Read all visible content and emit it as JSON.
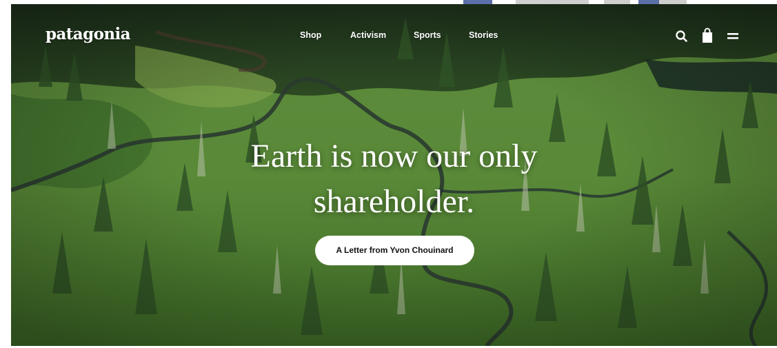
{
  "brand": {
    "logo_text": "patagonia"
  },
  "nav": {
    "items": [
      {
        "label": "Shop"
      },
      {
        "label": "Activism"
      },
      {
        "label": "Sports"
      },
      {
        "label": "Stories"
      }
    ]
  },
  "header_icons": [
    {
      "name": "search-icon"
    },
    {
      "name": "shopping-bag-icon"
    },
    {
      "name": "menu-icon"
    }
  ],
  "hero": {
    "headline_line1": "Earth is now our only",
    "headline_line2": "shareholder.",
    "cta_label": "A Letter from Yvon Chouinard",
    "image": "aerial view of green wetland forest with winding creek"
  },
  "colors": {
    "text": "#ffffff",
    "cta_bg": "#ffffff",
    "cta_text": "#111111",
    "forest": "#3f6a2a"
  }
}
